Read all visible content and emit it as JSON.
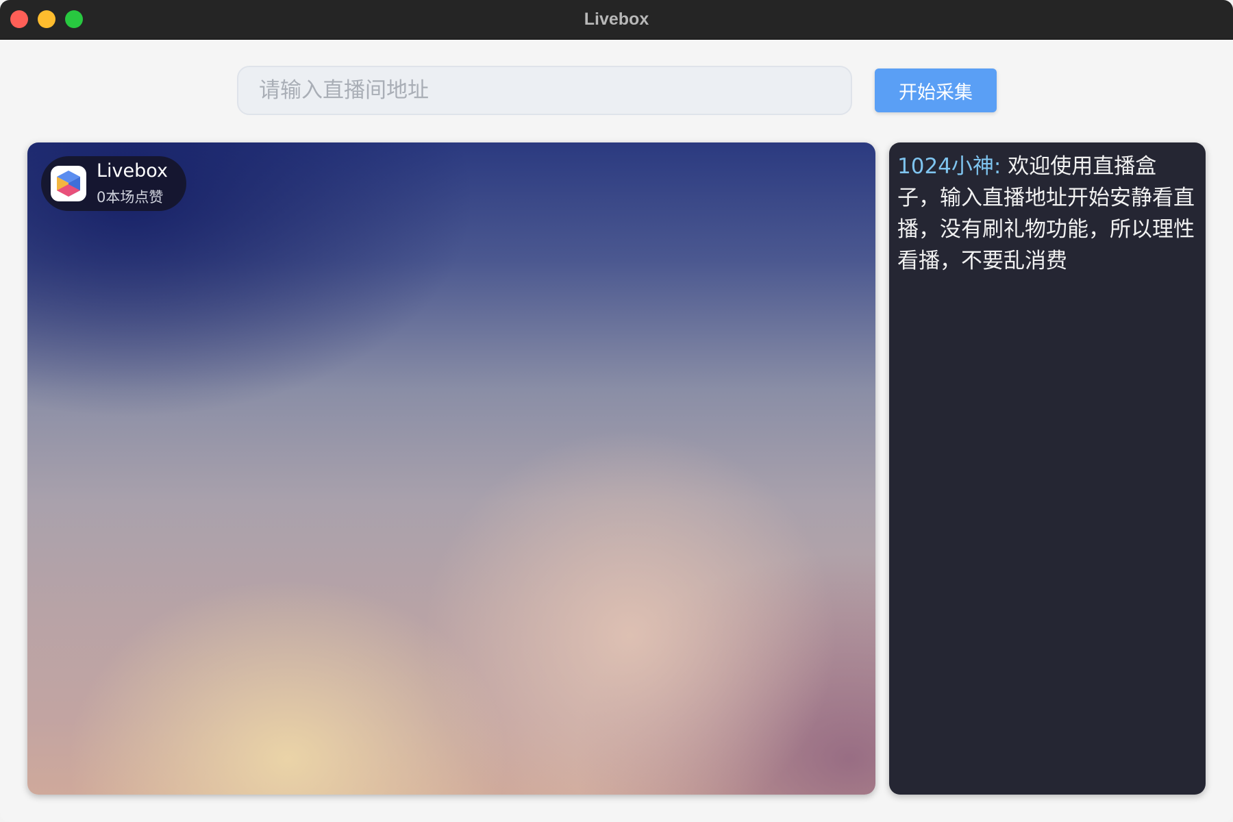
{
  "window": {
    "title": "Livebox"
  },
  "toolbar": {
    "url_placeholder": "请输入直播间地址",
    "url_value": "",
    "start_label": "开始采集"
  },
  "player": {
    "badge": {
      "logo_icon": "livebox-cube-icon",
      "name": "Livebox",
      "like_count": "0",
      "like_label": "本场点赞"
    }
  },
  "chat": {
    "messages": [
      {
        "user": "1024小神:",
        "text": "欢迎使用直播盒子，输入直播地址开始安静看直播，没有刷礼物功能，所以理性看播，不要乱消费"
      }
    ]
  },
  "colors": {
    "titlebar": "#252525",
    "accent_button": "#5a9ff5",
    "chat_background": "#252633",
    "chat_username": "#7fc4ef",
    "traffic_close": "#ff5f57",
    "traffic_minimize": "#febc2e",
    "traffic_maximize": "#28c840"
  }
}
